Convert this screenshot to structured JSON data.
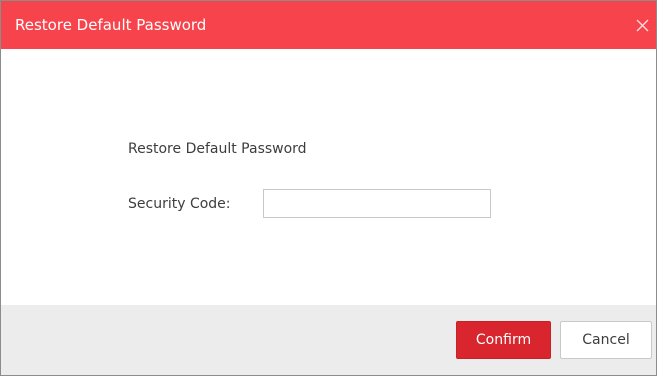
{
  "dialog": {
    "title": "Restore Default Password",
    "close_icon": "close-icon"
  },
  "form": {
    "heading": "Restore Default Password",
    "security_code_label": "Security Code:",
    "security_code_value": "",
    "security_code_placeholder": ""
  },
  "buttons": {
    "confirm_label": "Confirm",
    "cancel_label": "Cancel"
  },
  "colors": {
    "titlebar": "#f7434c",
    "confirm": "#d9262e",
    "footer": "#ececec"
  }
}
